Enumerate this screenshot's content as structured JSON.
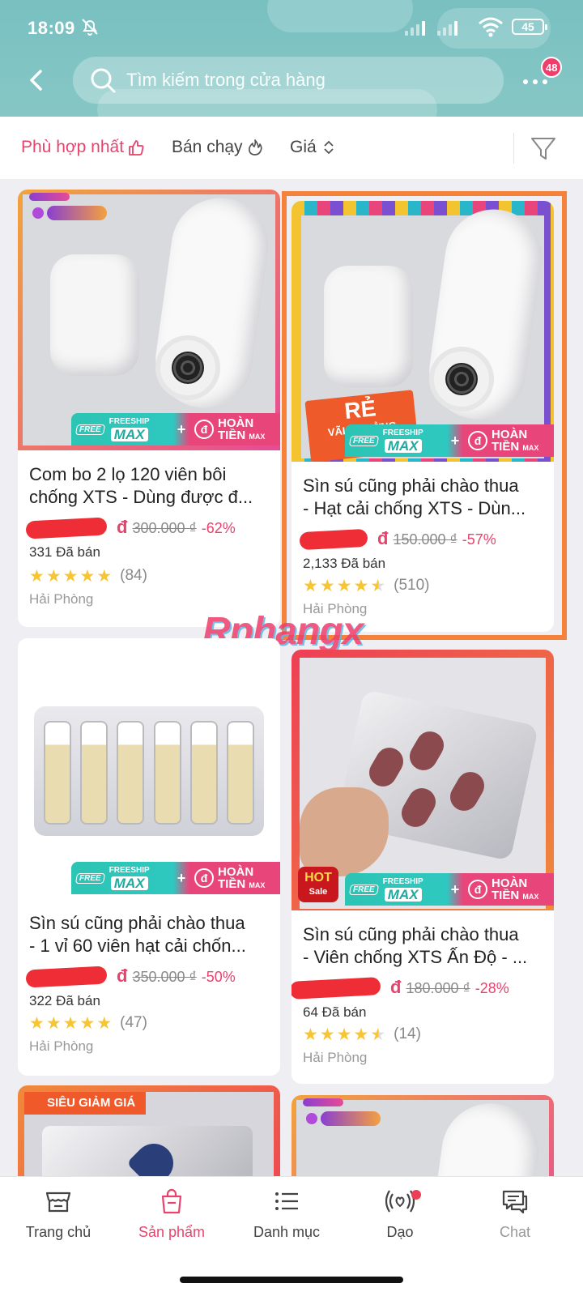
{
  "status_bar": {
    "time": "18:09",
    "battery": "45"
  },
  "search": {
    "placeholder": "Tìm kiếm trong cửa hàng"
  },
  "header": {
    "notification_count": "48"
  },
  "sort_tabs": [
    {
      "label": "Phù hợp nhất",
      "active": true
    },
    {
      "label": "Bán chạy",
      "active": false
    },
    {
      "label": "Giá",
      "active": false
    }
  ],
  "badges": {
    "freeship_tag": "FREE",
    "freeship_top": "FREESHIP",
    "freeship_max": "MAX",
    "hoan_line1": "HOÀN",
    "hoan_line2": "TIỀN",
    "hoan_max": "MAX",
    "re_text": "RẺ",
    "re_sub": "VÃI CHƯỞNG",
    "hot": "HOT",
    "hot_sub": "Sale",
    "sieu_giam_gia": "SIÊU GIẢM GIÁ"
  },
  "products": [
    {
      "title_line1": "Com bo 2 lọ 120 viên bôi",
      "title_line2": "chống XTS - Dùng được đ...",
      "price_now": "đ",
      "price_old": "300.000 ₫",
      "discount": "-62%",
      "sold": "331 Đã bán",
      "stars": 5,
      "rating_count": "(84)",
      "location": "Hải Phòng"
    },
    {
      "title_line1": "Sìn sú cũng phải chào thua",
      "title_line2": "- Hạt cải chống XTS - Dùn...",
      "price_now": "đ",
      "price_old": "150.000 ₫",
      "discount": "-57%",
      "sold": "2,133 Đã bán",
      "stars": 4.5,
      "rating_count": "(510)",
      "location": "Hải Phòng"
    },
    {
      "title_line1": "Sìn sú cũng phải chào thua",
      "title_line2": "- 1 vỉ 60 viên hạt cải chốn...",
      "price_now": "đ",
      "price_old": "350.000 ₫",
      "discount": "-50%",
      "sold": "322 Đã bán",
      "stars": 5,
      "rating_count": "(47)",
      "location": "Hải Phòng"
    },
    {
      "title_line1": "Sìn sú cũng phải chào thua",
      "title_line2": "- Viên chống XTS Ấn Độ - ...",
      "price_now": "đ",
      "price_old": "180.000 ₫",
      "discount": "-28%",
      "sold": "64 Đã bán",
      "stars": 4.5,
      "rating_count": "(14)",
      "location": "Hải Phòng"
    }
  ],
  "watermark": "Rphangx",
  "bottom_nav": [
    {
      "label": "Trang chủ",
      "icon": "store-icon",
      "active": false
    },
    {
      "label": "Sản phẩm",
      "icon": "shopping-bag-icon",
      "active": true
    },
    {
      "label": "Danh mục",
      "icon": "list-icon",
      "active": false
    },
    {
      "label": "Dạo",
      "icon": "live-icon",
      "active": false
    },
    {
      "label": "Chat",
      "icon": "chat-icon",
      "active": false
    }
  ],
  "colors": {
    "accent": "#e8436d",
    "header_bg": "#7fc3c3",
    "teal": "#2cc4b3",
    "highlight_frame": "#f5823a"
  }
}
